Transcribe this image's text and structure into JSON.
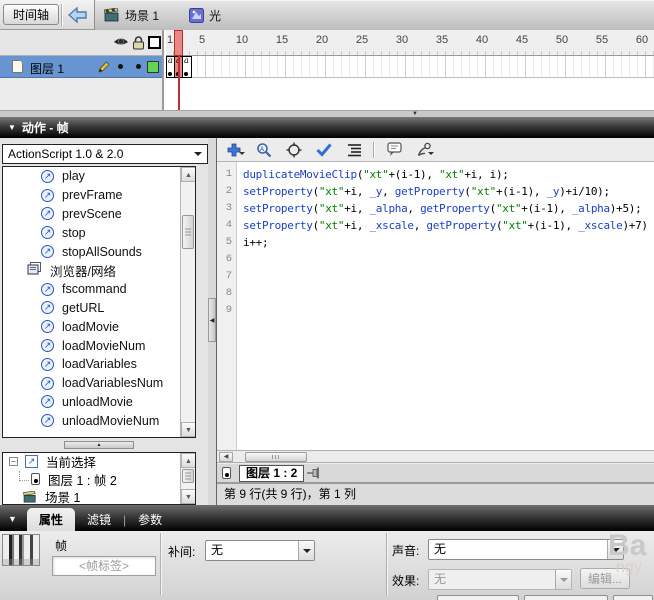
{
  "topbar": {
    "timeline_tab": "时间轴",
    "scene": "场景 1",
    "symbol": "光"
  },
  "timeline": {
    "layer_name": "图层 1",
    "ruler_numbers": [
      1,
      5,
      10,
      15,
      20,
      25,
      30,
      35,
      40,
      45,
      50,
      55,
      60
    ],
    "keyframe_label": "a",
    "action_frames": 3,
    "playhead_frame": 2
  },
  "actions": {
    "panel_title": "动作 - 帧",
    "language": "ActionScript 1.0 & 2.0",
    "tree": [
      {
        "icon": "action",
        "label": "play"
      },
      {
        "icon": "action",
        "label": "prevFrame"
      },
      {
        "icon": "action",
        "label": "prevScene"
      },
      {
        "icon": "action",
        "label": "stop"
      },
      {
        "icon": "action",
        "label": "stopAllSounds"
      },
      {
        "icon": "book",
        "label": "浏览器/网络"
      },
      {
        "icon": "action",
        "label": "fscommand"
      },
      {
        "icon": "action",
        "label": "getURL"
      },
      {
        "icon": "action",
        "label": "loadMovie"
      },
      {
        "icon": "action",
        "label": "loadMovieNum"
      },
      {
        "icon": "action",
        "label": "loadVariables"
      },
      {
        "icon": "action",
        "label": "loadVariablesNum"
      },
      {
        "icon": "action",
        "label": "unloadMovie"
      },
      {
        "icon": "action",
        "label": "unloadMovieNum"
      }
    ],
    "selection": {
      "root": "当前选择",
      "frame": "图层 1 : 帧 2",
      "scene": "场景 1"
    },
    "toolbar_icons": [
      "add-statement",
      "find-replace",
      "insert-target-path",
      "check-syntax",
      "auto-format",
      "show-code-hint",
      "debug-options"
    ],
    "script_tab": "图层 1 : 2",
    "status": "第 9 行(共 9 行)，第 1 列",
    "code_lines": [
      [
        [
          "k",
          "duplicateMovieClip"
        ],
        [
          "n",
          "("
        ],
        [
          "s",
          "\"xt\""
        ],
        [
          "n",
          "+(i-1), "
        ],
        [
          "s",
          "\"xt\""
        ],
        [
          "n",
          "+i, i);"
        ]
      ],
      [
        [
          "k",
          "setProperty"
        ],
        [
          "n",
          "("
        ],
        [
          "s",
          "\"xt\""
        ],
        [
          "n",
          "+i, "
        ],
        [
          "k",
          "_y"
        ],
        [
          "n",
          ", "
        ],
        [
          "k",
          "getProperty"
        ],
        [
          "n",
          "("
        ],
        [
          "s",
          "\"xt\""
        ],
        [
          "n",
          "+(i-1), "
        ],
        [
          "k",
          "_y"
        ],
        [
          "n",
          ")+i/10);"
        ]
      ],
      [
        [
          "k",
          "setProperty"
        ],
        [
          "n",
          "("
        ],
        [
          "s",
          "\"xt\""
        ],
        [
          "n",
          "+i, "
        ],
        [
          "k",
          "_alpha"
        ],
        [
          "n",
          ", "
        ],
        [
          "k",
          "getProperty"
        ],
        [
          "n",
          "("
        ],
        [
          "s",
          "\"xt\""
        ],
        [
          "n",
          "+(i-1), "
        ],
        [
          "k",
          "_alpha"
        ],
        [
          "n",
          ")+5);"
        ]
      ],
      [
        [
          "k",
          "setProperty"
        ],
        [
          "n",
          "("
        ],
        [
          "s",
          "\"xt\""
        ],
        [
          "n",
          "+i, "
        ],
        [
          "k",
          "_xscale"
        ],
        [
          "n",
          ", "
        ],
        [
          "k",
          "getProperty"
        ],
        [
          "n",
          "("
        ],
        [
          "s",
          "\"xt\""
        ],
        [
          "n",
          "+(i-1), "
        ],
        [
          "k",
          "_xscale"
        ],
        [
          "n",
          ")+7)"
        ]
      ],
      [
        [
          "n",
          "i++;"
        ]
      ],
      [],
      [],
      [],
      []
    ]
  },
  "properties": {
    "tabs": {
      "properties": "属性",
      "filters": "滤镜",
      "parameters": "参数"
    },
    "element_type": "帧",
    "frame_label_placeholder": "<帧标签>",
    "tween_label": "补间:",
    "tween_value": "无",
    "sound_label": "声音:",
    "sound_value": "无",
    "effect_label": "效果:",
    "effect_value": "无",
    "edit_button": "编辑...",
    "watermark_top": "Ba",
    "watermark_bottom": "ngy"
  },
  "colors": {
    "layer_selection": "#6795d1",
    "playhead_red": "#c03232",
    "keyword_blue": "#1c3fc4",
    "string_green": "#007d00",
    "outline_swatch_green": "#5fd84f"
  }
}
